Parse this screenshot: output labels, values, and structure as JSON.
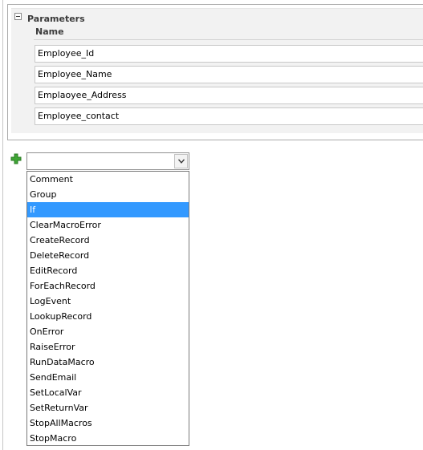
{
  "parameters": {
    "title": "Parameters",
    "column_header": "Name",
    "rows": [
      "Employee_Id",
      "Employee_Name",
      "Emplaoyee_Address",
      "Employee_contact"
    ]
  },
  "action_combo": {
    "value": "",
    "add_icon": "green-plus-icon",
    "open_icon": "chevron-down-icon"
  },
  "dropdown": {
    "selected": "If",
    "items": [
      "Comment",
      "Group",
      "If",
      "ClearMacroError",
      "CreateRecord",
      "DeleteRecord",
      "EditRecord",
      "ForEachRecord",
      "LogEvent",
      "LookupRecord",
      "OnError",
      "RaiseError",
      "RunDataMacro",
      "SendEmail",
      "SetLocalVar",
      "SetReturnVar",
      "StopAllMacros",
      "StopMacro"
    ]
  },
  "colors": {
    "selection": "#3399ff",
    "panel": "#f2f2f2",
    "add_icon": "#3fa535"
  }
}
